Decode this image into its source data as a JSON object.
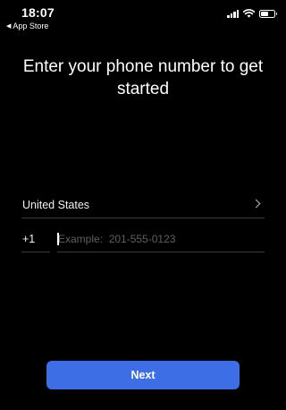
{
  "status_bar": {
    "time": "18:07",
    "back_label": "App Store",
    "back_icon": "triangle-left-icon",
    "icons": [
      "cellular-signal-icon",
      "wifi-icon",
      "battery-icon"
    ],
    "battery_level": 0.55
  },
  "headline": "Enter your phone number to get started",
  "country": {
    "label": "United States",
    "icon": "chevron-right-icon"
  },
  "phone": {
    "dial_code": "+1",
    "placeholder": "Example:  201-555-0123",
    "value": ""
  },
  "next_button": {
    "label": "Next"
  },
  "colors": {
    "background": "#000000",
    "accent": "#3e6ee6",
    "divider": "#3a3a3c",
    "placeholder": "#5f5f63"
  }
}
